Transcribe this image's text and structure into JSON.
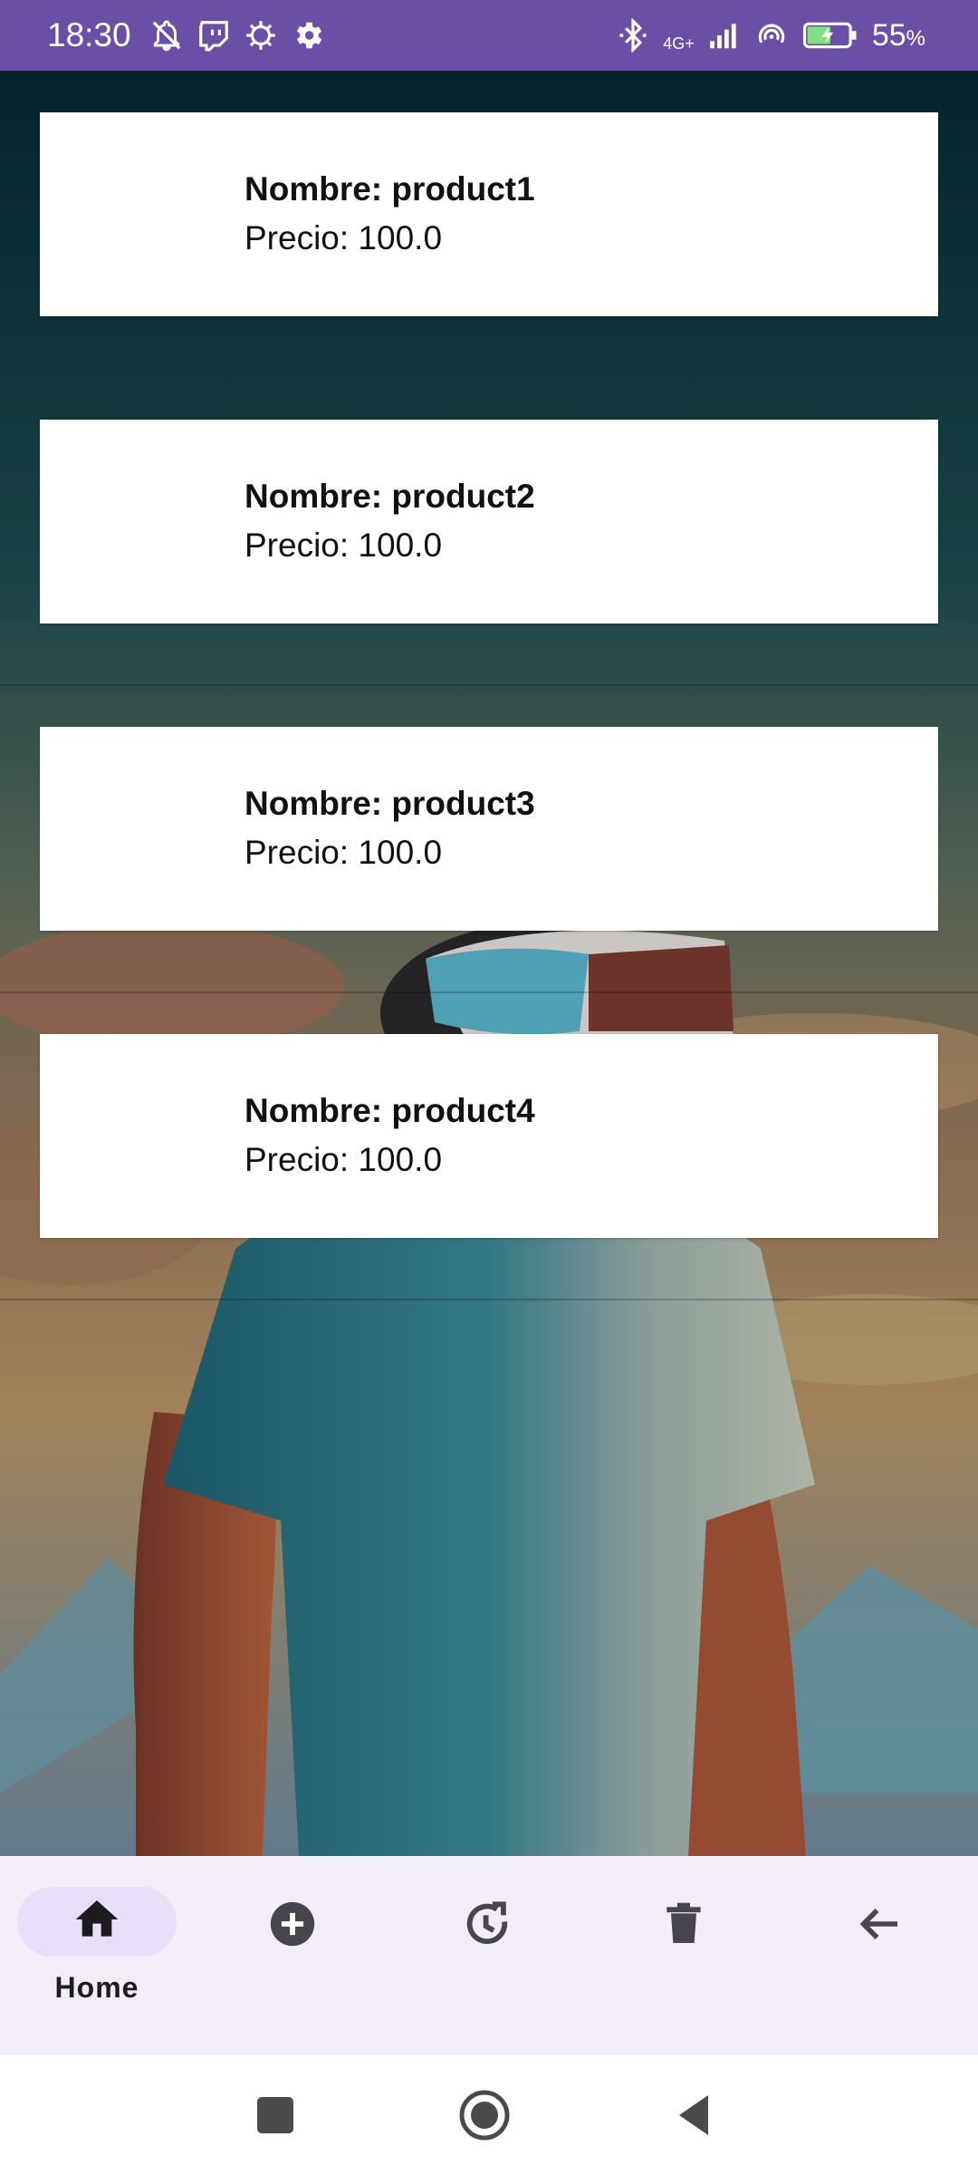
{
  "status_bar": {
    "time": "18:30",
    "network": "4G+",
    "battery": "55",
    "battery_unit": "%",
    "icons": [
      "notifications-off-icon",
      "twitch-icon",
      "bug-icon",
      "settings-icon",
      "bluetooth-icon",
      "signal-icon",
      "hotspot-icon",
      "battery-charging-icon"
    ]
  },
  "products": [
    {
      "name": "Nombre: product1",
      "price": "Precio: 100.0"
    },
    {
      "name": "Nombre: product2",
      "price": "Precio: 100.0"
    },
    {
      "name": "Nombre: product3",
      "price": "Precio: 100.0"
    },
    {
      "name": "Nombre: product4",
      "price": "Precio: 100.0"
    }
  ],
  "bottom_nav": {
    "items": [
      {
        "label": "Home",
        "icon": "home-icon",
        "active": true
      },
      {
        "label": "",
        "icon": "add-circle-icon",
        "active": false
      },
      {
        "label": "",
        "icon": "history-icon",
        "active": false
      },
      {
        "label": "",
        "icon": "delete-icon",
        "active": false
      },
      {
        "label": "",
        "icon": "arrow-back-icon",
        "active": false
      }
    ]
  },
  "system_nav": {
    "icons": [
      "recents-square-icon",
      "home-circle-icon",
      "back-triangle-icon"
    ]
  },
  "colors": {
    "status_bar": "#6b4fa6",
    "nav_background": "#f3edf8",
    "nav_active_pill": "#e8def8",
    "card_background": "#ffffff"
  }
}
